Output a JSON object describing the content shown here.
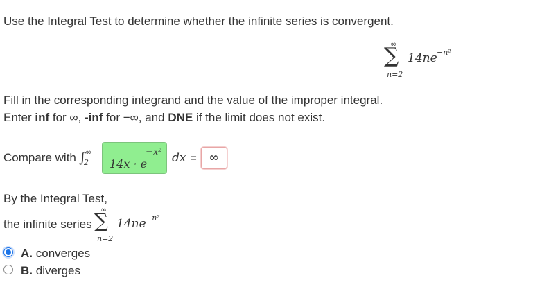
{
  "question": {
    "instruction": "Use the Integral Test to determine whether the infinite series is convergent."
  },
  "series": {
    "sigma": "∑",
    "upper": "∞",
    "lower": "n=2",
    "term": "14ne",
    "exponent": "−n²"
  },
  "fill_in": {
    "line1": "Fill in the corresponding integrand and the value of the improper integral.",
    "line2_parts": {
      "enter": "Enter ",
      "inf": "inf",
      "for1": " for ∞, ",
      "neg_inf": "-inf",
      "for2": " for −∞, and ",
      "dne": "DNE",
      "rest": " if the limit does not exist."
    }
  },
  "compare": {
    "label": "Compare with",
    "integral_sign": "∫",
    "upper": "∞",
    "lower": "2",
    "integrand_value": "14x · e",
    "integrand_exponent": "−x²",
    "dx": "dx",
    "equals": "=",
    "integral_value": "∞"
  },
  "conclusion": {
    "by_test": "By the Integral Test,",
    "the_series": "the infinite series",
    "options": [
      {
        "letter": "A.",
        "text": "converges",
        "selected": true
      },
      {
        "letter": "B.",
        "text": "diverges",
        "selected": false
      }
    ]
  },
  "colors": {
    "correct_fill": "#90ee90",
    "error_border": "#e8a6a6",
    "radio_selected": "#1a73e8"
  }
}
